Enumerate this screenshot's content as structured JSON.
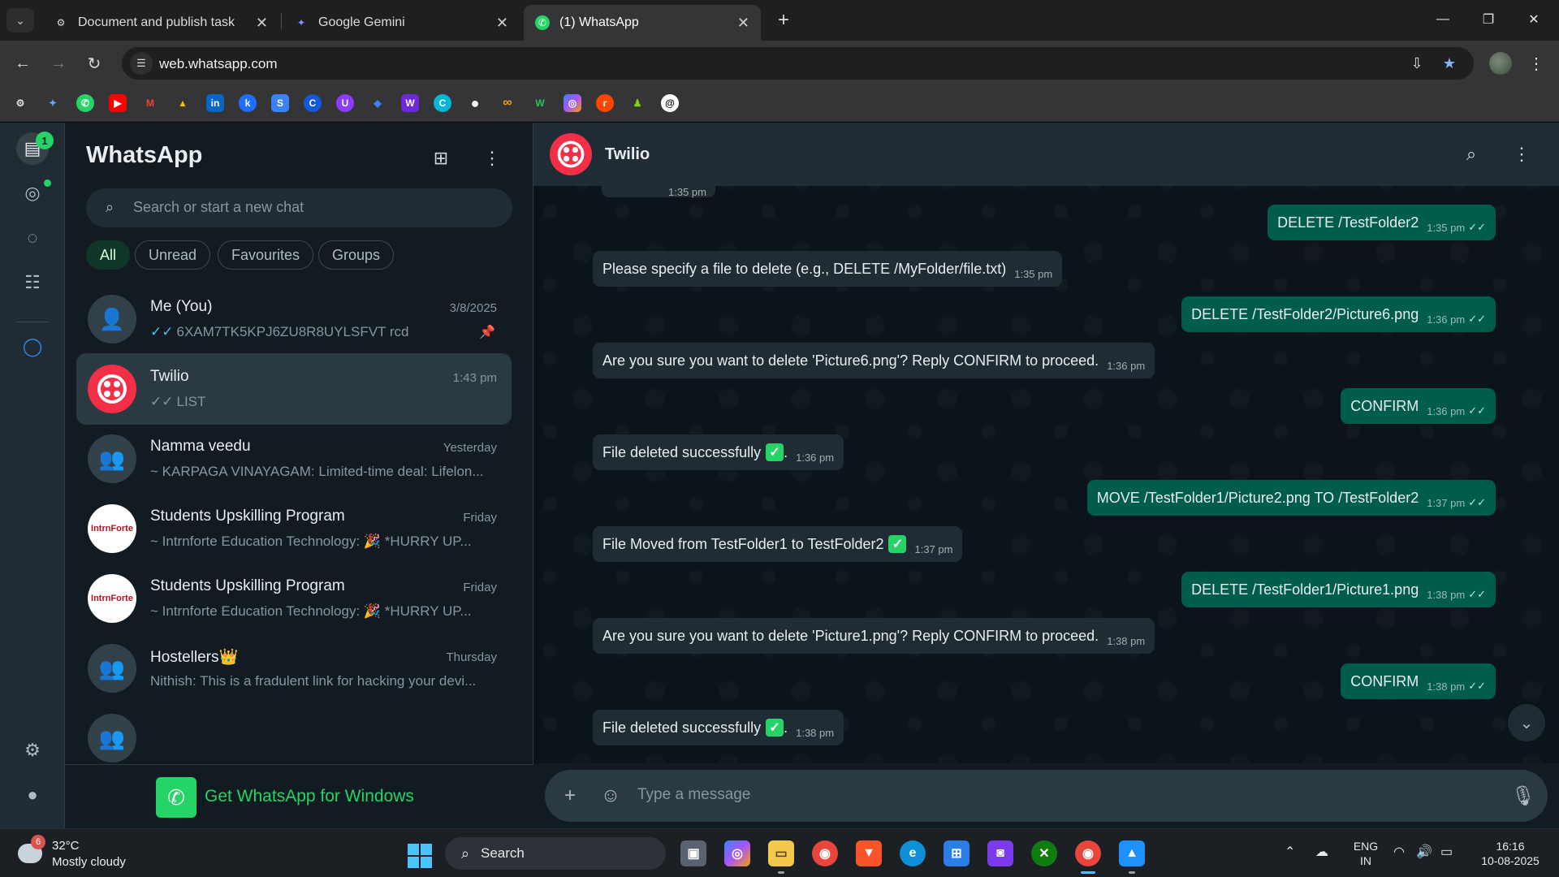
{
  "browser": {
    "tabs": [
      {
        "title": "Document and publish task",
        "icon": "openai-icon"
      },
      {
        "title": "Google Gemini",
        "icon": "gemini-icon"
      },
      {
        "title": "(1) WhatsApp",
        "icon": "whatsapp-icon",
        "active": true
      }
    ],
    "url": "web.whatsapp.com",
    "bookmarks": [
      "openai",
      "gemini",
      "whatsapp",
      "youtube",
      "gmail",
      "google-drive",
      "linkedin",
      "krea",
      "ls",
      "canva",
      "proton",
      "cloudflare",
      "twitch",
      "copilot",
      "github",
      "meta",
      "webflow",
      "microsoft-365",
      "reddit",
      "chess",
      "threads"
    ]
  },
  "whatsapp": {
    "title": "WhatsApp",
    "rail_badge": "1",
    "search_placeholder": "Search or start a new chat",
    "filters": [
      "All",
      "Unread",
      "Favourites",
      "Groups"
    ],
    "chats": [
      {
        "name": "Me (You)",
        "time": "3/8/2025",
        "message": "6XAM7TK5KPJ6ZU8R8UYLSFVT   rcd",
        "ticks": "✓✓",
        "pinned": true
      },
      {
        "name": "Twilio",
        "time": "1:43 pm",
        "message": "LIST",
        "ticks": "✓✓",
        "selected": true
      },
      {
        "name": "Namma veedu",
        "time": "Yesterday",
        "message": "~ KARPAGA VINAYAGAM: Limited-time deal: Lifelon..."
      },
      {
        "name": "Students Upskilling Program",
        "time": "Friday",
        "message": "~ Intrnforte Education Technology: 🎉 *HURRY UP...",
        "avatar_text": "IntrnForte"
      },
      {
        "name": "Students Upskilling Program",
        "time": "Friday",
        "message": "~ Intrnforte Education Technology: 🎉 *HURRY UP...",
        "avatar_text": "IntrnForte"
      },
      {
        "name": "Hostellers👑",
        "time": "Thursday",
        "message": "Nithish: This is a fradulent link for hacking your devi..."
      }
    ],
    "promo": "Get WhatsApp for Windows",
    "active_chat": {
      "name": "Twilio",
      "top_stub_time": "1:35 pm",
      "messages": [
        {
          "dir": "out",
          "text": "DELETE /TestFolder2",
          "time": "1:35 pm"
        },
        {
          "dir": "in",
          "text": "Please specify a file to delete (e.g., DELETE /MyFolder/file.txt)",
          "time": "1:35 pm"
        },
        {
          "dir": "out",
          "text": "DELETE /TestFolder2/Picture6.png",
          "time": "1:36 pm"
        },
        {
          "dir": "in",
          "text": "Are you sure you want to delete 'Picture6.png'? Reply CONFIRM to proceed.",
          "time": "1:36 pm"
        },
        {
          "dir": "out",
          "text": "CONFIRM",
          "time": "1:36 pm"
        },
        {
          "dir": "in",
          "text": "File deleted successfully",
          "time": "1:36 pm",
          "check": true
        },
        {
          "dir": "out",
          "text": "MOVE /TestFolder1/Picture2.png TO /TestFolder2",
          "time": "1:37 pm"
        },
        {
          "dir": "in",
          "text": "File Moved from TestFolder1 to TestFolder2",
          "time": "1:37 pm",
          "check": true
        },
        {
          "dir": "out",
          "text": "DELETE /TestFolder1/Picture1.png",
          "time": "1:38 pm"
        },
        {
          "dir": "in",
          "text": "Are you sure you want to delete 'Picture1.png'? Reply CONFIRM to proceed.",
          "time": "1:38 pm"
        },
        {
          "dir": "out",
          "text": "CONFIRM",
          "time": "1:38 pm"
        },
        {
          "dir": "in",
          "text": "File deleted successfully",
          "time": "1:38 pm",
          "check": true
        }
      ],
      "compose_placeholder": "Type a message"
    }
  },
  "taskbar": {
    "weather_badge": "6",
    "temperature": "32°C",
    "condition": "Mostly cloudy",
    "search_label": "Search",
    "language_line1": "ENG",
    "language_line2": "IN",
    "time": "16:16",
    "date": "10-08-2025"
  },
  "colors": {
    "accent": "#25d366",
    "outgoing_bubble": "#005c4b",
    "incoming_bubble": "#202c33",
    "twilio_red": "#f22f46"
  }
}
